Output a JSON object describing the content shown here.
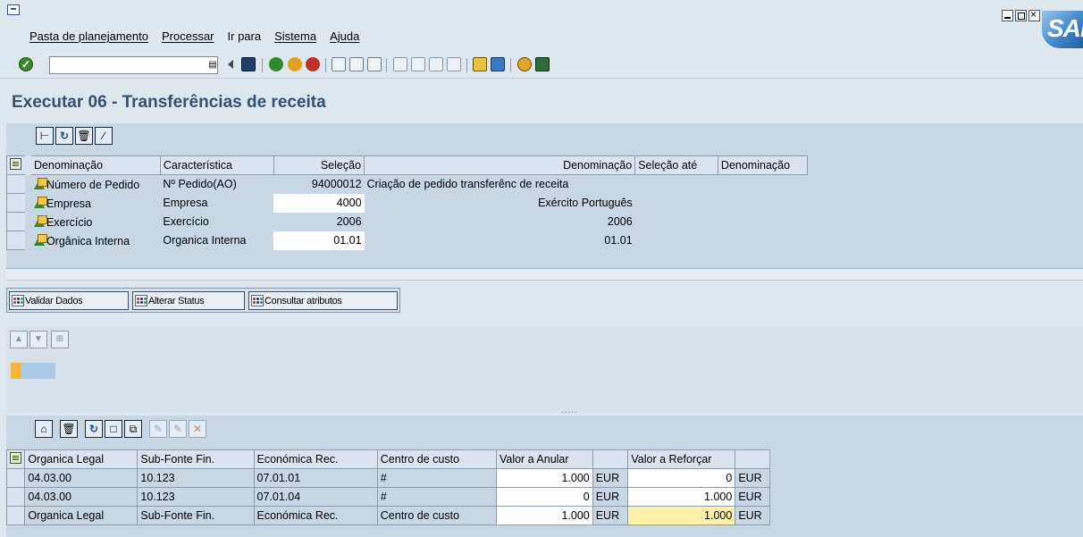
{
  "menu": {
    "items": [
      "Pasta de planejamento",
      "Processar",
      "Ir para",
      "Sistema",
      "Ajuda"
    ]
  },
  "toolbar": {
    "command_value": "",
    "icons": [
      "enter-icon",
      "save-icon",
      "back-icon",
      "exit-icon",
      "cancel-icon",
      "print-icon",
      "find-icon",
      "find-next-icon",
      "first-page-icon",
      "previous-page-icon",
      "next-page-icon",
      "last-page-icon",
      "create-session-icon",
      "shortcut-icon",
      "help-icon",
      "layout-icon"
    ]
  },
  "page": {
    "title": "Executar 06 - Transferências de receita"
  },
  "selection_grid": {
    "headers": [
      "Denominação",
      "Característica",
      "Seleção",
      "Denominação",
      "Seleção até",
      "Denominação"
    ],
    "rows": [
      {
        "name": "Número de Pedido",
        "char": "Nº Pedido(AO)",
        "sel": "94000012",
        "desc": "Criação de pedido transferênc de receita",
        "sel_to": "",
        "desc2": ""
      },
      {
        "name": "Empresa",
        "char": "Empresa",
        "sel": "4000",
        "desc": "Exército Português",
        "sel_to": "",
        "desc2": ""
      },
      {
        "name": "Exercício",
        "char": "Exercício",
        "sel": "2006",
        "desc": "2006",
        "sel_to": "",
        "desc2": ""
      },
      {
        "name": "Orgânica Interna",
        "char": "Organica Interna",
        "sel": "01.01",
        "desc": "01.01",
        "sel_to": "",
        "desc2": ""
      }
    ]
  },
  "actions": {
    "validate": "Validar Dados",
    "change_status": "Alterar Status",
    "attributes": "Consultar atributos"
  },
  "data_grid": {
    "headers": [
      "Organica Legal",
      "Sub-Fonte Fin.",
      "Económica Rec.",
      "Centro de custo",
      "Valor a Anular",
      "",
      "Valor a Reforçar",
      ""
    ],
    "rows": [
      {
        "org": "04.03.00",
        "sub": "10.123",
        "eco": "07.01.01",
        "cc": "#",
        "anular": "1.000",
        "cur1": "EUR",
        "reforcar": "0",
        "cur2": "EUR"
      },
      {
        "org": "04.03.00",
        "sub": "10.123",
        "eco": "07.01.04",
        "cc": "#",
        "anular": "0",
        "cur1": "EUR",
        "reforcar": "1.000",
        "cur2": "EUR"
      },
      {
        "org": "Organica Legal",
        "sub": "Sub-Fonte Fin.",
        "eco": "Económica Rec.",
        "cc": "Centro de custo",
        "anular": "1.000",
        "cur1": "EUR",
        "reforcar": "1.000",
        "cur2": "EUR"
      }
    ]
  },
  "brand": {
    "logo": "SAP"
  }
}
